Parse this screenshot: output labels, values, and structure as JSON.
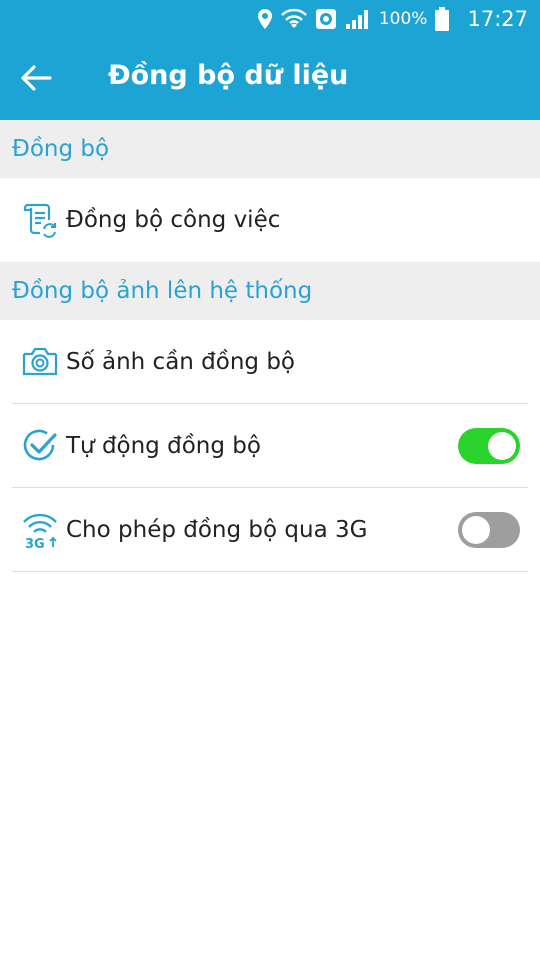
{
  "status_bar": {
    "battery": "100%",
    "time": "17:27",
    "icons": [
      "location-icon",
      "wifi-icon",
      "browser-icon",
      "signal-icon",
      "battery-icon"
    ]
  },
  "toolbar": {
    "back_icon": "arrow-left-icon",
    "title": "Đồng bộ dữ liệu"
  },
  "sections": [
    {
      "header": "Đồng bộ",
      "items": [
        {
          "label": "Đồng bộ công việc",
          "icon": "task-sync-icon"
        }
      ]
    },
    {
      "header": "Đồng bộ ảnh lên hệ thống",
      "items": [
        {
          "label": "Số ảnh cần đồng bộ",
          "icon": "camera-icon"
        },
        {
          "label": "Tự động đồng bộ",
          "icon": "check-circle-icon",
          "toggle": true
        },
        {
          "label": "Cho phép đồng bộ qua 3G",
          "icon": "wifi-3g-icon",
          "toggle": false
        }
      ]
    }
  ],
  "colors": {
    "header_bg": "#1ba4d4",
    "section_text": "#2aa3d3",
    "toggle_on": "#2ad32a",
    "toggle_off": "#9e9e9e"
  }
}
